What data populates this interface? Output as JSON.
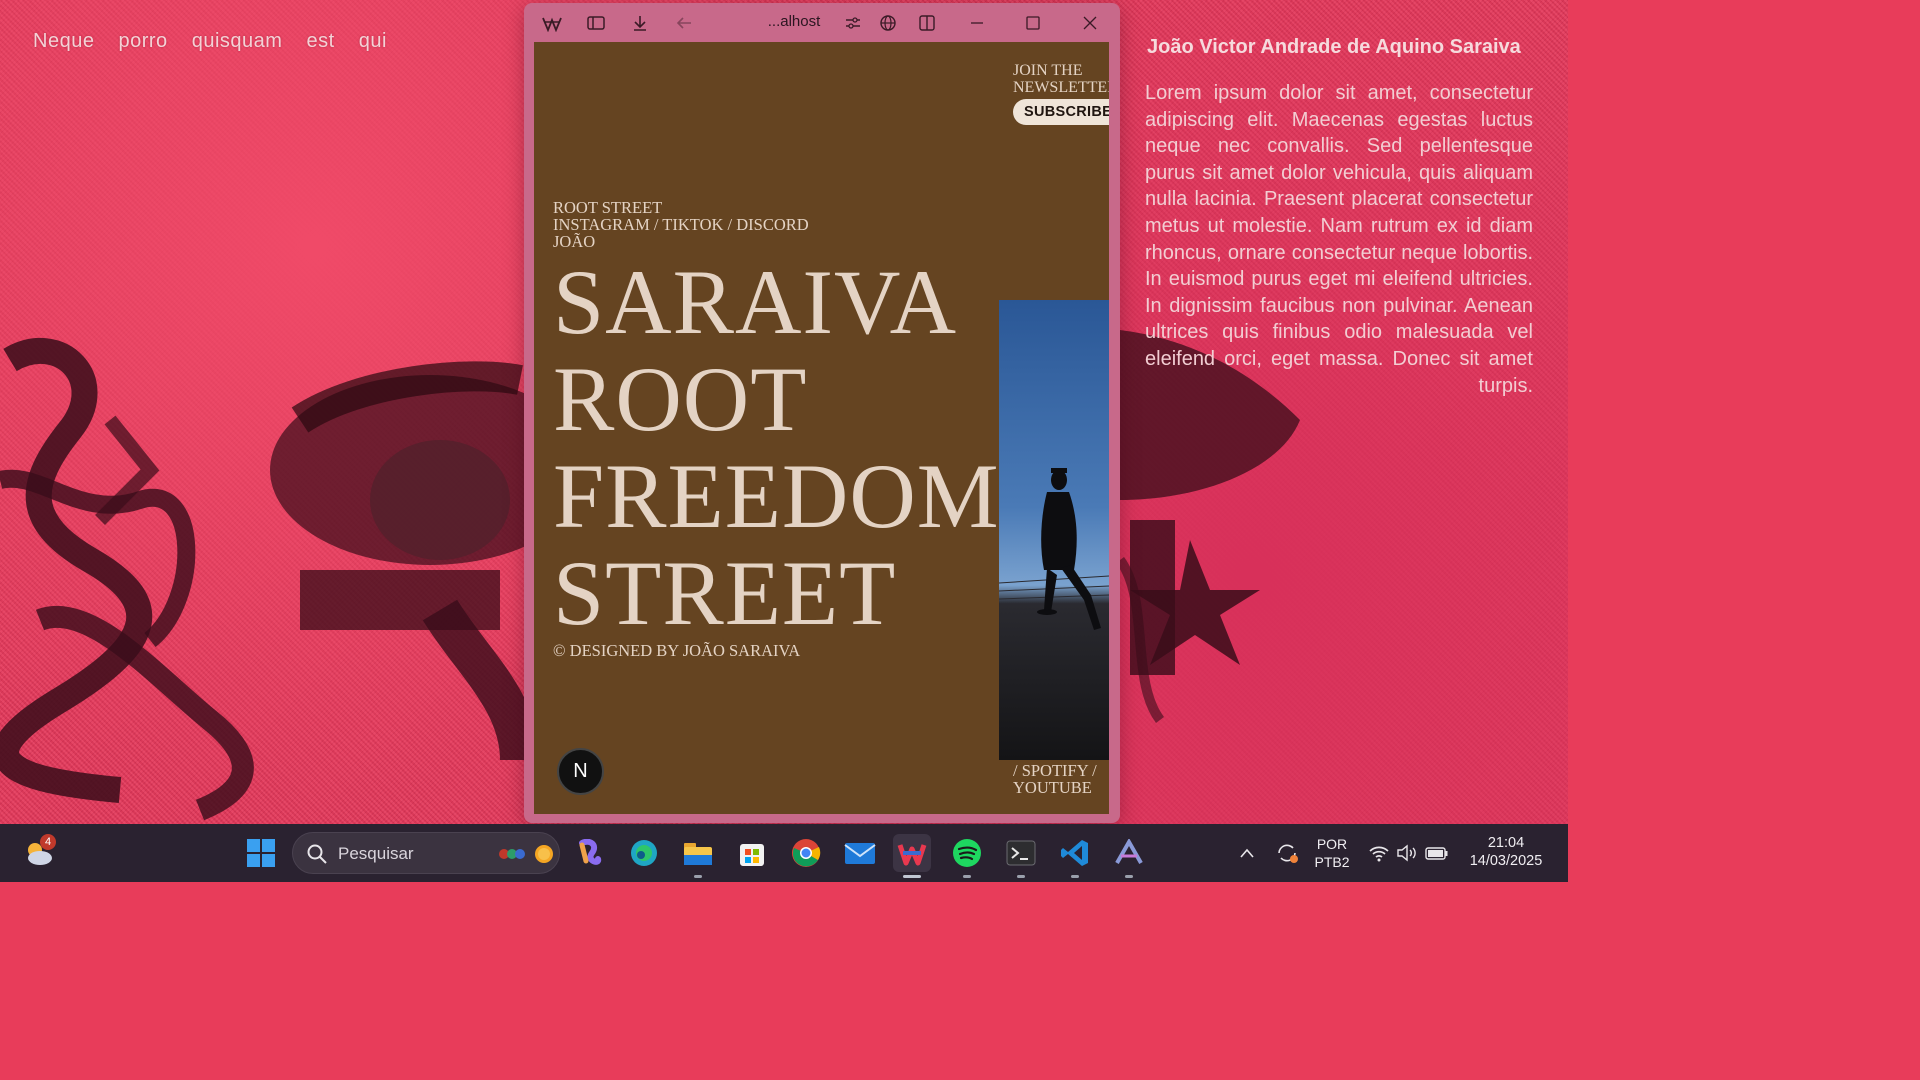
{
  "desktop": {
    "left_words": "Neque porro quisquam est qui",
    "right_title": "João Victor Andrade de Aquino Saraiva",
    "right_paragraph": "Lorem ipsum dolor sit amet, consectetur adipiscing elit. Maecenas egestas luctus neque nec convallis. Sed pellentesque purus sit amet dolor vehicula, quis aliquam nulla lacinia. Praesent placerat consectetur metus ut molestie. Nam rutrum ex id diam rhoncus, ornare consectetur neque lobortis. In euismod purus eget mi eleifend ultricies. In dignissim faucibus non pulvinar. Aenean ultrices quis finibus odio malesuada vel eleifend orci, eget massa. Donec sit amet turpis."
  },
  "browser": {
    "url": "...alhost",
    "page": {
      "newsletter_line1": "JOIN THE",
      "newsletter_line2": "NEWSLETTER",
      "subscribe_label": "SUBSCRIBE",
      "nav_line1": "ROOT STREET",
      "nav_line2": "INSTAGRAM / TIKTOK / DISCORD",
      "nav_line3": "JOÃO",
      "headline": [
        "SARAIVA",
        "ROOT",
        "FREEDOM",
        "STREET"
      ],
      "credit": "© DESIGNED BY JOÃO SARAIVA",
      "social_line1": "/ SPOTIFY /",
      "social_line2": "YOUTUBE",
      "next_badge": "N"
    },
    "colors": {
      "page_bg": "#654421",
      "text": "#e4d3c4",
      "frame": "#c8698a"
    }
  },
  "taskbar": {
    "weather_badge": "4",
    "search_placeholder": "Pesquisar",
    "lang_line1": "POR",
    "lang_line2": "PTB2",
    "time": "21:04",
    "date": "14/03/2025"
  }
}
